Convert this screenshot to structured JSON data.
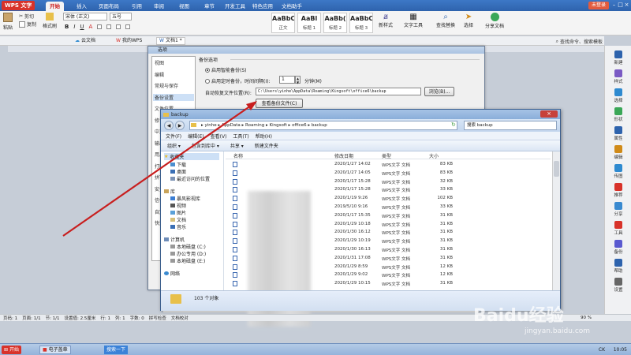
{
  "app": {
    "logo": "WPS 文字",
    "login": "未登录"
  },
  "menu_tabs": [
    "开始",
    "插入",
    "页面布局",
    "引用",
    "审阅",
    "视图",
    "章节",
    "开发工具",
    "特色应用",
    "文档助手"
  ],
  "ribbon": {
    "paste": "粘贴",
    "cut": "剪切",
    "copy": "复制",
    "format_painter": "格式刷",
    "font_name": "宋体 (正文)",
    "font_size": "五号",
    "styles": [
      {
        "preview": "AaBbCcDd",
        "label": "正文"
      },
      {
        "preview": "AaBl",
        "label": "标题 1"
      },
      {
        "preview": "AaBb(",
        "label": "标题 2"
      },
      {
        "preview": "AaBbC",
        "label": "标题 3"
      }
    ],
    "new_style": "新样式",
    "text_tools": "文字工具",
    "find_replace": "查找替换",
    "select": "选择",
    "share_doc": "分享文档"
  },
  "doc_tabs": [
    {
      "label": "云文档"
    },
    {
      "label": "我的WPS"
    },
    {
      "label": "文档1 *"
    }
  ],
  "search_right": "查找命令、搜索模板",
  "right_sidebar": [
    "新建",
    "样式",
    "选择",
    "形状",
    "属性",
    "编辑",
    "传图",
    "推荐",
    "分享",
    "工具",
    "备份",
    "帮助",
    "设置"
  ],
  "options": {
    "title": "选项",
    "left_items": [
      "视图",
      "编辑",
      "常规与保存",
      "备份设置",
      "文件位置",
      "修订",
      "中文版式",
      "输出PDF",
      "用户信息",
      "打印",
      "拼写检查",
      "安全性",
      "信任中心",
      "自定义功能区",
      "快速访问工具栏"
    ],
    "section_title": "备份选项",
    "radio1": "启用智能备份(S)",
    "radio2": "启用定时备份，时间间隔(I):",
    "interval": "1",
    "minutes": "分钟(M)",
    "location_label": "自动恢复文件位置(R):",
    "location_value": "C:\\Users\\yinhe\\AppData\\Roaming\\Kingsoft\\office6\\backup",
    "browse": "浏览(B)...",
    "view_backup": "查看备份文件(C)"
  },
  "explorer": {
    "title": "backup",
    "path": "▸ yinhe ▸ AppData ▸ Roaming ▸ Kingsoft ▸ office6 ▸ backup",
    "search_placeholder": "搜索 backup",
    "menu": [
      "文件(F)",
      "编辑(E)",
      "查看(V)",
      "工具(T)",
      "帮助(H)"
    ],
    "toolbar": [
      "组织 ▾",
      "包含到库中 ▾",
      "共享 ▾",
      "新建文件夹"
    ],
    "nav": {
      "favorites": "收藏夹",
      "downloads": "下载",
      "desktop": "桌面",
      "recent": "最近访问的位置",
      "library": "库",
      "video_lib": "暴风影视库",
      "videos": "视频",
      "pictures": "图片",
      "documents": "文档",
      "music": "音乐",
      "computer": "计算机",
      "drive_c": "本地磁盘 (C:)",
      "drive_d": "办公专用 (D:)",
      "drive_e": "本地磁盘 (E:)",
      "network": "网络"
    },
    "columns": [
      "名称",
      "修改日期",
      "类型",
      "大小"
    ],
    "rows": [
      {
        "date": "2020/1/27 14:02",
        "type": "WPS文字 文档",
        "size": "83 KB"
      },
      {
        "date": "2020/1/27 14:05",
        "type": "WPS文字 文档",
        "size": "83 KB"
      },
      {
        "date": "2020/1/17 15:28",
        "type": "WPS文字 文档",
        "size": "32 KB"
      },
      {
        "date": "2020/1/17 15:28",
        "type": "WPS文字 文档",
        "size": "33 KB"
      },
      {
        "date": "2020/1/19 9:26",
        "type": "WPS文字 文档",
        "size": "102 KB"
      },
      {
        "date": "2019/5/10 9:16",
        "type": "WPS文字 文档",
        "size": "33 KB"
      },
      {
        "date": "2020/1/17 15:35",
        "type": "WPS文字 文档",
        "size": "31 KB"
      },
      {
        "date": "2020/1/29 10:18",
        "type": "WPS文字 文档",
        "size": "31 KB"
      },
      {
        "date": "2020/1/30 16:12",
        "type": "WPS文字 文档",
        "size": "31 KB"
      },
      {
        "date": "2020/1/29 10:19",
        "type": "WPS文字 文档",
        "size": "31 KB"
      },
      {
        "date": "2020/1/30 16:13",
        "type": "WPS文字 文档",
        "size": "31 KB"
      },
      {
        "date": "2020/1/31 17:08",
        "type": "WPS文字 文档",
        "size": "31 KB"
      },
      {
        "date": "2020/1/29 8:59",
        "type": "WPS文字 文档",
        "size": "12 KB"
      },
      {
        "date": "2020/1/29 9:02",
        "type": "WPS文字 文档",
        "size": "12 KB"
      },
      {
        "date": "2020/1/29 10:15",
        "type": "WPS文字 文档",
        "size": "31 KB"
      }
    ],
    "status": "103 个对象"
  },
  "statusbar": {
    "items": [
      "页码: 1",
      "页面: 1/1",
      "节: 1/1",
      "设置值: 2.5厘米",
      "行: 1",
      "列: 1",
      "字数: 0",
      "拼写检查",
      "文档校对"
    ],
    "zoom": "90 %"
  },
  "taskbar": {
    "start": "开始",
    "app1": "电子盖章",
    "app2": "搜索一下",
    "time": "10:05",
    "lang": "CK"
  },
  "watermark": {
    "brand": "Baidu经验",
    "url": "jingyan.baidu.com"
  },
  "colors": {
    "title_blue": "#2e63ad",
    "accent_red": "#d8322a",
    "arrow": "#c81e1e",
    "selection": "#cde0f6"
  }
}
